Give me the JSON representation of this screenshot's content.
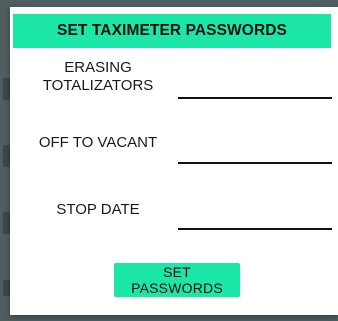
{
  "dialog": {
    "title": "SET TAXIMETER PASSWORDS",
    "fields": [
      {
        "label_line1": "ERASING",
        "label_line2": "TOTALIZATORS",
        "value": ""
      },
      {
        "label": "OFF TO VACANT",
        "value": ""
      },
      {
        "label": "STOP DATE",
        "value": ""
      }
    ],
    "submit_label": "SET PASSWORDS"
  },
  "colors": {
    "accent": "#1de7a8",
    "background_overlay": "#4f5f60",
    "dialog_background": "#ffffff",
    "text": "#111111"
  }
}
